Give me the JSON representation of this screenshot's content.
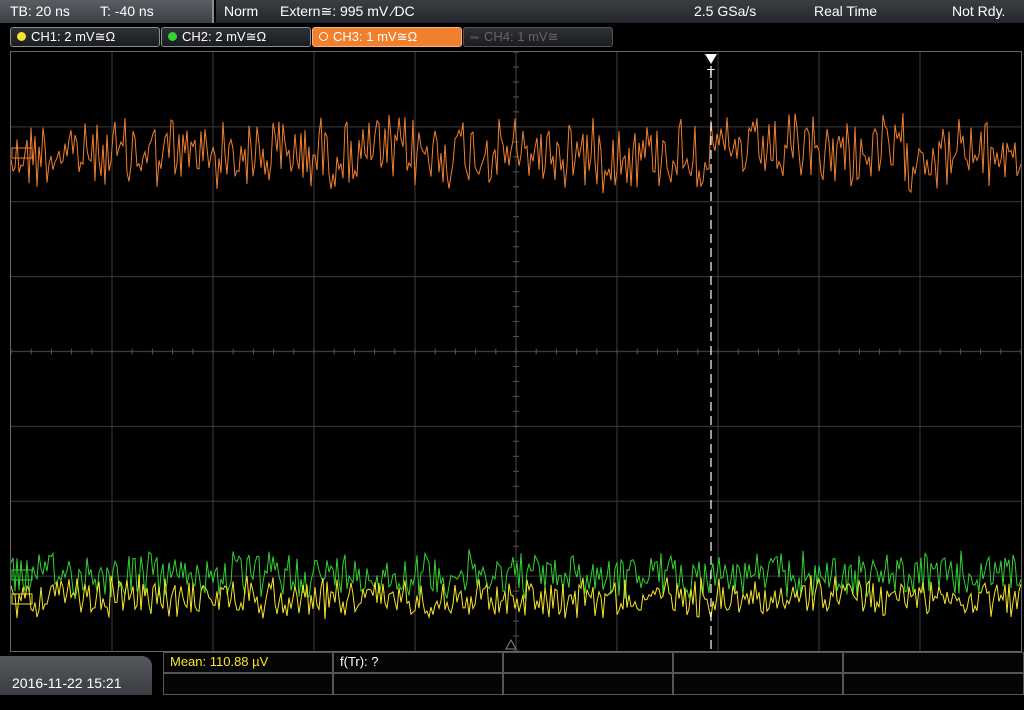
{
  "timebase": {
    "tb": "TB: 20 ns",
    "t": "T: -40 ns"
  },
  "status": {
    "trigger_mode": "Norm",
    "trigger_source": "Extern≅: 995 mV ⁄DC",
    "sample_rate": "2.5 GSa/s",
    "acq_mode": "Real Time",
    "state": "Not Rdy."
  },
  "channels": [
    {
      "label": "CH1: 2 mV≅Ω",
      "color": "#f5e62a",
      "state": "on"
    },
    {
      "label": "CH2: 2 mV≅Ω",
      "color": "#32d232",
      "state": "on"
    },
    {
      "label": "CH3: 1 mV≅Ω",
      "color": "#f07f2e",
      "state": "active"
    },
    {
      "label": "CH4: 1 mV≅",
      "color": "#555555",
      "state": "off"
    }
  ],
  "trigger_marker": "T",
  "measurements": {
    "mean": "Mean: 110.88 µV",
    "freq": "f(Tr): ?"
  },
  "datetime": "2016-11-22 15:21",
  "colors": {
    "ch1": "#f5e62a",
    "ch2": "#32d232",
    "ch3": "#f07f2e",
    "grid": "#3c3c3c"
  }
}
